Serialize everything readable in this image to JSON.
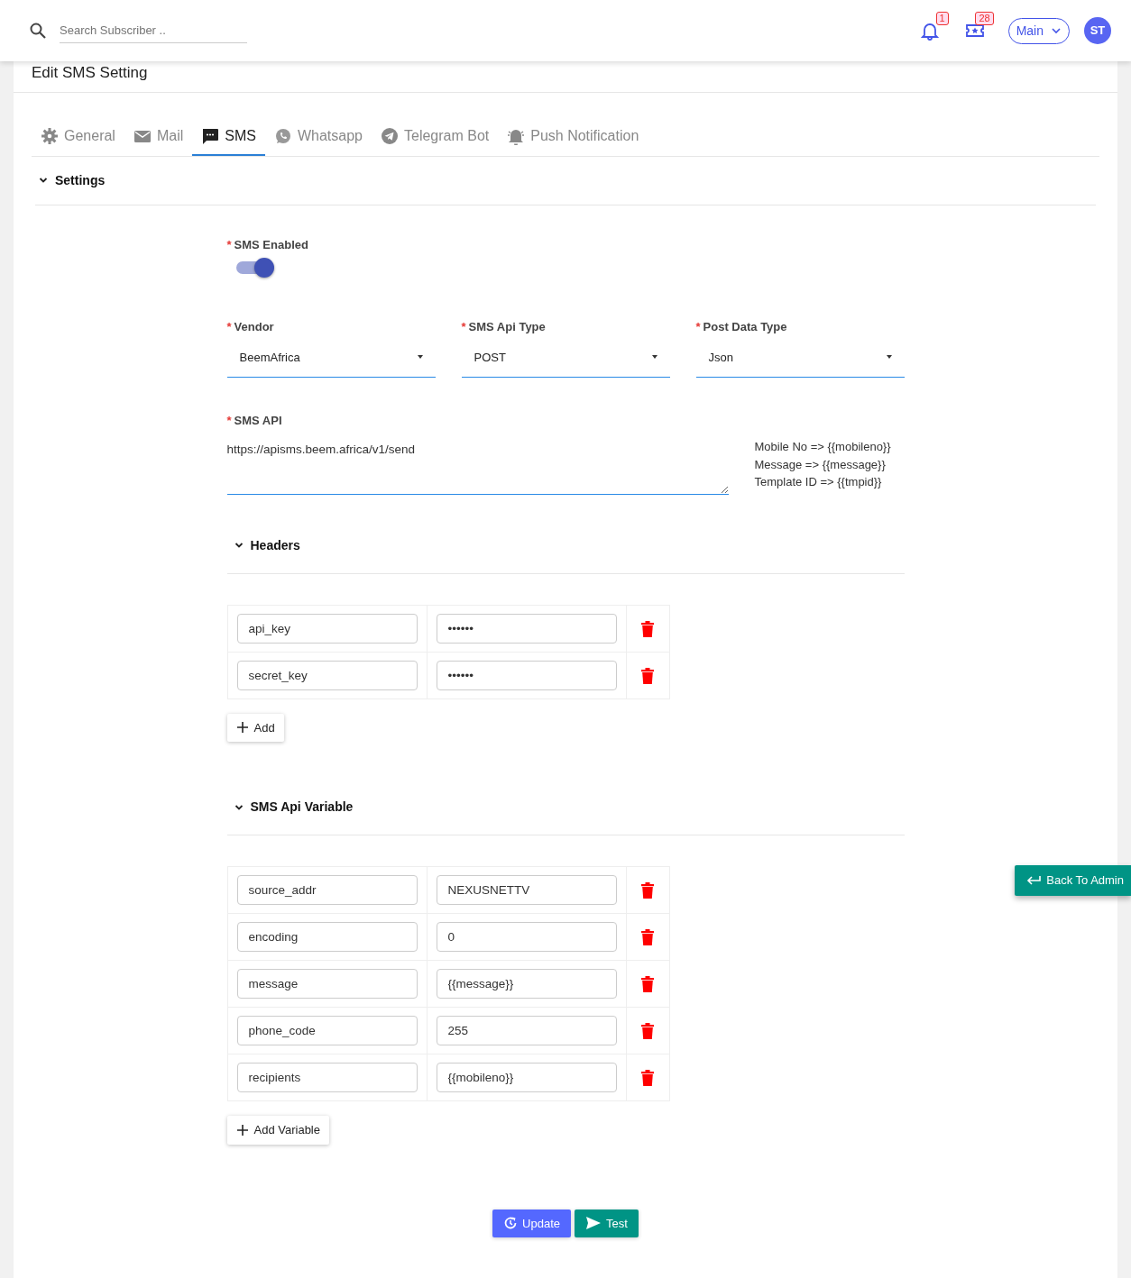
{
  "search": {
    "placeholder": "Search Subscriber .."
  },
  "header_icons": [
    {
      "kind": "bell",
      "badge": "1"
    },
    {
      "kind": "ticket",
      "badge": "28"
    }
  ],
  "workspace_button": "Main",
  "avatar": "ST",
  "page_title": "Edit SMS Setting",
  "tabs": [
    {
      "label": "General",
      "kind": "gear",
      "selected": false
    },
    {
      "label": "Mail",
      "kind": "mail",
      "selected": false
    },
    {
      "label": "SMS",
      "kind": "chat",
      "selected": true
    },
    {
      "label": "Whatsapp",
      "kind": "whatsapp",
      "selected": false
    },
    {
      "label": "Telegram Bot",
      "kind": "telegram",
      "selected": false
    },
    {
      "label": "Push Notification",
      "kind": "bell",
      "selected": false
    }
  ],
  "settings_section": {
    "title": "Settings",
    "expanded": true
  },
  "sms_enabled": {
    "required_mark": "*",
    "label": "SMS Enabled",
    "on": true
  },
  "selects": [
    {
      "required_mark": "*",
      "label": "Vendor",
      "value": "BeemAfrica"
    },
    {
      "required_mark": "*",
      "label": "SMS Api Type",
      "value": "POST"
    },
    {
      "required_mark": "*",
      "label": "Post Data Type",
      "value": "Json"
    }
  ],
  "sms_api": {
    "required_mark": "*",
    "label": "SMS API",
    "value": "https://apisms.beem.africa/v1/send"
  },
  "hints": [
    "Mobile No => {{mobileno}}",
    "Message => {{message}}",
    "Template ID => {{tmpid}}"
  ],
  "groups": [
    {
      "title": "Headers",
      "expanded": true,
      "add_button": "Add",
      "rows": [
        {
          "key": "api_key",
          "value": "••••••"
        },
        {
          "key": "secret_key",
          "value": "••••••"
        }
      ]
    },
    {
      "title": "SMS Api Variable",
      "expanded": true,
      "add_button": "Add Variable",
      "rows": [
        {
          "key": "source_addr",
          "value": "NEXUSNETTV"
        },
        {
          "key": "encoding",
          "value": "0"
        },
        {
          "key": "message",
          "value": "{{message}}"
        },
        {
          "key": "phone_code",
          "value": "255"
        },
        {
          "key": "recipients",
          "value": "{{mobileno}}"
        }
      ]
    }
  ],
  "actions": [
    {
      "label": "Update",
      "kind": "update"
    },
    {
      "label": "Test",
      "kind": "test"
    }
  ],
  "back_button": "Back To Admin"
}
